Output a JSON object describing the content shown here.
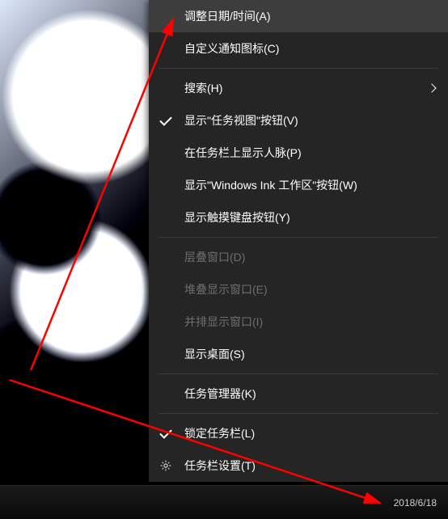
{
  "menu": {
    "adjust_datetime": "调整日期/时间(A)",
    "customize_icons": "自定义通知图标(C)",
    "search": "搜索(H)",
    "show_taskview_btn": "显示\"任务视图\"按钮(V)",
    "show_people": "在任务栏上显示人脉(P)",
    "show_wink_btn": "显示\"Windows Ink 工作区\"按钮(W)",
    "show_touchkb_btn": "显示触摸键盘按钮(Y)",
    "cascade": "层叠窗口(D)",
    "stacked": "堆叠显示窗口(E)",
    "sidebyside": "并排显示窗口(I)",
    "show_desktop": "显示桌面(S)",
    "task_manager": "任务管理器(K)",
    "lock_taskbar": "锁定任务栏(L)",
    "taskbar_settings": "任务栏设置(T)"
  },
  "taskbar": {
    "date": "2018/6/18"
  }
}
